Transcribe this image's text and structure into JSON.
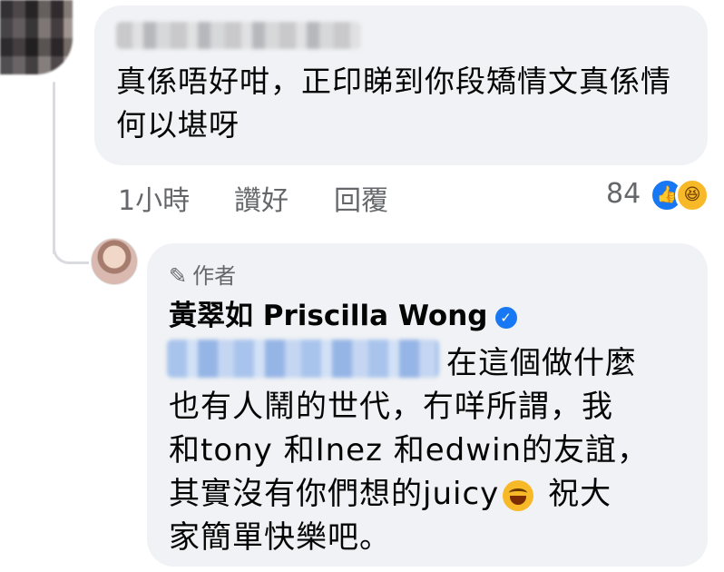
{
  "comment": {
    "text": "真係唔好咁，正印睇到你段矯情文真係情何以堪呀",
    "time": "1小時",
    "like_label": "讚好",
    "reply_label": "回覆",
    "reaction_count": "84",
    "reactions": [
      "like-icon",
      "haha-icon"
    ]
  },
  "reply": {
    "badge_label": "作者",
    "author_name": "黃翠如 Priscilla Wong",
    "verified": true,
    "line1": "在這個做什麼",
    "line2": "也有人鬧的世代，冇咩所謂，我",
    "line3": "和tony 和Inez 和edwin的友誼，",
    "line4a": "其實沒有你們想的juicy",
    "line4b": " 祝大",
    "line5": "家簡單快樂吧。"
  },
  "colors": {
    "bubble": "#f0f2f5",
    "meta": "#65676b",
    "like_blue": "#1877f2",
    "haha_yellow": "#f7b928"
  }
}
